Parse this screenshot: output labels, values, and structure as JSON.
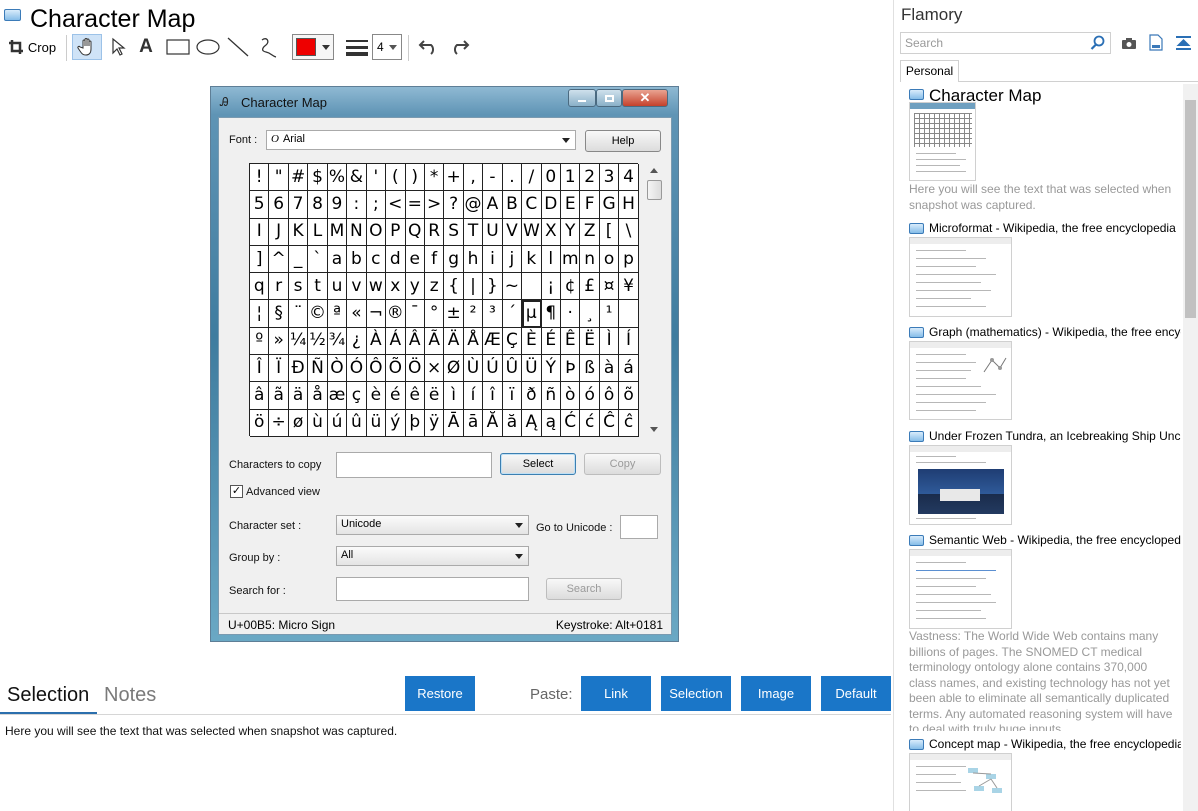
{
  "window": {
    "title": "Character Map"
  },
  "toolbar": {
    "crop_label": "Crop",
    "tools": [
      "crop-icon",
      "hand-icon",
      "pointer-icon",
      "text-icon",
      "rectangle-icon",
      "ellipse-icon",
      "line-icon",
      "freehand-icon",
      "color-picker",
      "line-width-icon",
      "undo-icon",
      "redo-icon"
    ],
    "color": "#ee0000",
    "line_width": "4"
  },
  "charmap": {
    "title": "Character Map",
    "font_label": "Font :",
    "font_value": "Arial",
    "help_button": "Help",
    "rows": [
      [
        "!",
        "\"",
        "#",
        "$",
        "%",
        "&",
        "'",
        "(",
        ")",
        "*",
        "+",
        ",",
        "-",
        ".",
        "/",
        "0",
        "1",
        "2",
        "3",
        "4"
      ],
      [
        "5",
        "6",
        "7",
        "8",
        "9",
        ":",
        ";",
        "<",
        "=",
        ">",
        "?",
        "@",
        "A",
        "B",
        "C",
        "D",
        "E",
        "F",
        "G",
        "H"
      ],
      [
        "I",
        "J",
        "K",
        "L",
        "M",
        "N",
        "O",
        "P",
        "Q",
        "R",
        "S",
        "T",
        "U",
        "V",
        "W",
        "X",
        "Y",
        "Z",
        "[",
        "\\"
      ],
      [
        "]",
        "^",
        "_",
        "`",
        "a",
        "b",
        "c",
        "d",
        "e",
        "f",
        "g",
        "h",
        "i",
        "j",
        "k",
        "l",
        "m",
        "n",
        "o",
        "p"
      ],
      [
        "q",
        "r",
        "s",
        "t",
        "u",
        "v",
        "w",
        "x",
        "y",
        "z",
        "{",
        "|",
        "}",
        "~",
        " ",
        "¡",
        "¢",
        "£",
        "¤",
        "¥"
      ],
      [
        "¦",
        "§",
        "¨",
        "©",
        "ª",
        "«",
        "¬",
        "®",
        "¯",
        "°",
        "±",
        "²",
        "³",
        "´",
        "µ",
        "¶",
        "·",
        "¸",
        "¹",
        ""
      ],
      [
        "º",
        "»",
        "¼",
        "½",
        "¾",
        "¿",
        "À",
        "Á",
        "Â",
        "Ã",
        "Ä",
        "Å",
        "Æ",
        "Ç",
        "È",
        "É",
        "Ê",
        "Ë",
        "Ì",
        "Í"
      ],
      [
        "Î",
        "Ï",
        "Ð",
        "Ñ",
        "Ò",
        "Ó",
        "Ô",
        "Õ",
        "Ö",
        "×",
        "Ø",
        "Ù",
        "Ú",
        "Û",
        "Ü",
        "Ý",
        "Þ",
        "ß",
        "à",
        "á"
      ],
      [
        "â",
        "ã",
        "ä",
        "å",
        "æ",
        "ç",
        "è",
        "é",
        "ê",
        "ë",
        "ì",
        "í",
        "î",
        "ï",
        "ð",
        "ñ",
        "ò",
        "ó",
        "ô",
        "õ"
      ],
      [
        "ö",
        "÷",
        "ø",
        "ù",
        "ú",
        "û",
        "ü",
        "ý",
        "þ",
        "ÿ",
        "Ā",
        "ā",
        "Ă",
        "ă",
        "Ą",
        "ą",
        "Ć",
        "ć",
        "Ĉ",
        "ĉ"
      ]
    ],
    "selected_cell": [
      5,
      14
    ],
    "chars_to_copy_label": "Characters to copy",
    "chars_to_copy_value": "",
    "select_button": "Select",
    "copy_button": "Copy",
    "advanced_label": "Advanced view",
    "advanced_checked": true,
    "charset_label": "Character set :",
    "charset_value": "Unicode",
    "goto_label": "Go to Unicode :",
    "groupby_label": "Group by :",
    "groupby_value": "All",
    "searchfor_label": "Search for :",
    "search_button": "Search",
    "status_left": "U+00B5: Micro Sign",
    "status_right": "Keystroke: Alt+0181"
  },
  "tabs": {
    "selection": "Selection",
    "notes": "Notes"
  },
  "actions": {
    "restore": "Restore",
    "paste_label": "Paste:",
    "link": "Link",
    "selection": "Selection",
    "image": "Image",
    "default": "Default"
  },
  "selection_text": "Here you will see the text that was selected when snapshot was captured.",
  "flamory": {
    "title": "Flamory",
    "search_placeholder": "Search",
    "tab": "Personal",
    "items": [
      {
        "title": "Character Map",
        "desc": "Here you will see the text that was selected when snapshot was captured."
      },
      {
        "title": "Microformat - Wikipedia, the free encyclopedia"
      },
      {
        "title": "Graph (mathematics) - Wikipedia, the free encyclopedia"
      },
      {
        "title": "Under Frozen Tundra, an Icebreaking Ship Uncovers..."
      },
      {
        "title": "Semantic Web - Wikipedia, the free encyclopedia",
        "desc": "Vastness: The World Wide Web contains many billions of pages. The SNOMED CT medical terminology ontology alone contains 370,000 class names, and existing technology has not yet been able to eliminate all semantically duplicated terms. Any automated reasoning system will have to deal with truly huge inputs."
      },
      {
        "title": "Concept map - Wikipedia, the free encyclopedia"
      }
    ]
  },
  "colors": {
    "accent": "#1a76c8",
    "pen": "#ee0000"
  }
}
